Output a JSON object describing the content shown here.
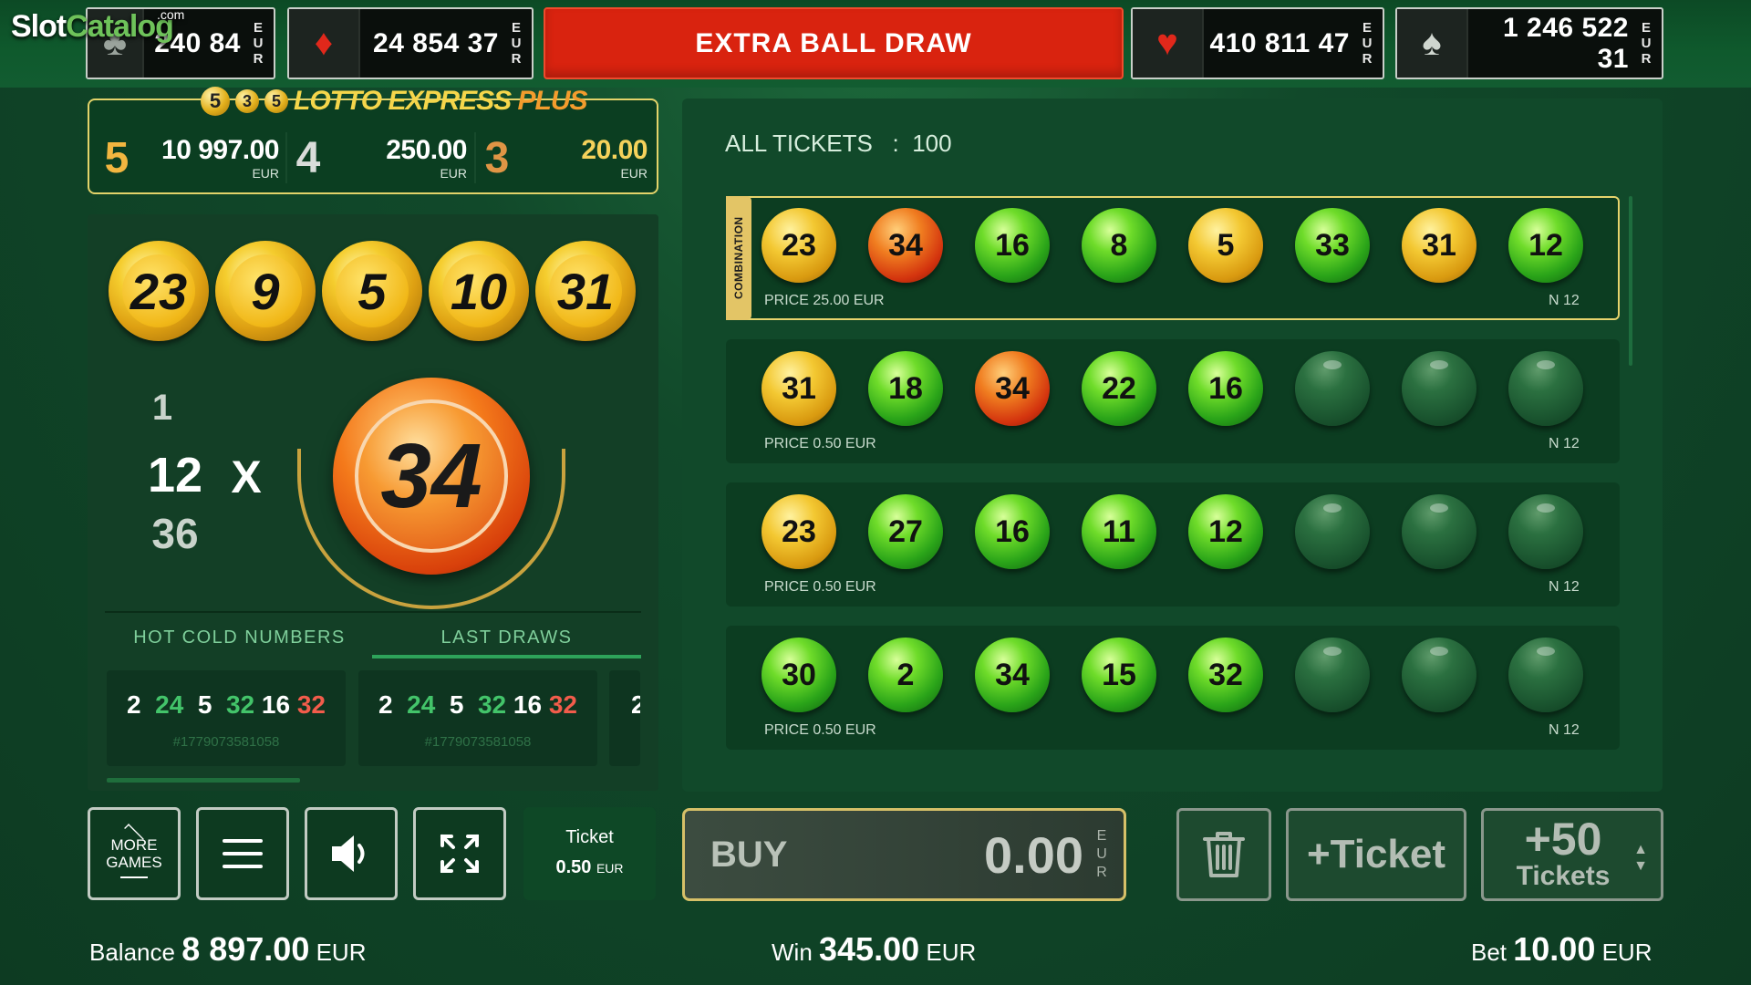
{
  "logo": {
    "slot": "Slot",
    "catalog": "Catalog",
    "com": ".com"
  },
  "jackpots": [
    {
      "suit": "club-icon",
      "value": "240 84",
      "currency": "EUR"
    },
    {
      "suit": "diamond-icon",
      "value": "24 854 37",
      "currency": "EUR"
    },
    {
      "suit": "heart-icon",
      "value": "410 811 47",
      "currency": "EUR"
    },
    {
      "suit": "spade-icon",
      "value": "1 246 522 31",
      "currency": "EUR"
    }
  ],
  "extra_ball_label": "EXTRA BALL DRAW",
  "paytable": {
    "title_balls": [
      "5",
      "3",
      "5"
    ],
    "title": "LOTTO EXPRESS",
    "title_plus": "PLUS",
    "rows": [
      {
        "match": "5",
        "amount": "10 997.00",
        "currency": "EUR"
      },
      {
        "match": "4",
        "amount": "250.00",
        "currency": "EUR"
      },
      {
        "match": "3",
        "amount": "20.00",
        "currency": "EUR"
      }
    ]
  },
  "drawn_balls": [
    "23",
    "9",
    "5",
    "10",
    "31"
  ],
  "current_ball": "34",
  "counter": {
    "prev": "1",
    "current": "12",
    "multiplier": "X",
    "total": "36"
  },
  "tabs": {
    "hot_cold": "HOT COLD NUMBERS",
    "last_draws": "LAST DRAWS"
  },
  "last_draws": [
    {
      "nums": [
        {
          "v": "2",
          "c": "w"
        },
        {
          "v": "24",
          "c": "g"
        },
        {
          "v": "5",
          "c": "w"
        },
        {
          "v": "32",
          "c": "g"
        },
        {
          "v": "16",
          "c": "w"
        },
        {
          "v": "32",
          "c": "r"
        }
      ],
      "id": "#1779073581058"
    },
    {
      "nums": [
        {
          "v": "2",
          "c": "w"
        },
        {
          "v": "24",
          "c": "g"
        },
        {
          "v": "5",
          "c": "w"
        },
        {
          "v": "32",
          "c": "g"
        },
        {
          "v": "16",
          "c": "w"
        },
        {
          "v": "32",
          "c": "r"
        }
      ],
      "id": "#1779073581058"
    },
    {
      "nums": [
        {
          "v": "2",
          "c": "w"
        }
      ],
      "id": ""
    }
  ],
  "buttons": {
    "more_games_1": "MORE",
    "more_games_2": "GAMES"
  },
  "ticket_box": {
    "label": "Ticket",
    "value": "0.50",
    "currency": "EUR"
  },
  "all_tickets": {
    "label": "ALL TICKETS",
    "sep": ":",
    "count": "100"
  },
  "combination_label": "COMBINATION",
  "tickets": [
    {
      "balls": [
        {
          "n": "23",
          "c": "gold"
        },
        {
          "n": "34",
          "c": "red"
        },
        {
          "n": "16",
          "c": "green"
        },
        {
          "n": "8",
          "c": "green"
        },
        {
          "n": "5",
          "c": "gold"
        },
        {
          "n": "33",
          "c": "green"
        },
        {
          "n": "31",
          "c": "gold"
        },
        {
          "n": "12",
          "c": "green"
        }
      ],
      "price": "PRICE 25.00 EUR",
      "n": "N 12"
    },
    {
      "balls": [
        {
          "n": "31",
          "c": "gold"
        },
        {
          "n": "18",
          "c": "green"
        },
        {
          "n": "34",
          "c": "red"
        },
        {
          "n": "22",
          "c": "green"
        },
        {
          "n": "16",
          "c": "green"
        },
        {
          "n": "",
          "c": "empty"
        },
        {
          "n": "",
          "c": "empty"
        },
        {
          "n": "",
          "c": "empty"
        }
      ],
      "price": "PRICE 0.50 EUR",
      "n": "N 12"
    },
    {
      "balls": [
        {
          "n": "23",
          "c": "gold"
        },
        {
          "n": "27",
          "c": "green"
        },
        {
          "n": "16",
          "c": "green"
        },
        {
          "n": "11",
          "c": "green"
        },
        {
          "n": "12",
          "c": "green"
        },
        {
          "n": "",
          "c": "empty"
        },
        {
          "n": "",
          "c": "empty"
        },
        {
          "n": "",
          "c": "empty"
        }
      ],
      "price": "PRICE 0.50 EUR",
      "n": "N 12"
    },
    {
      "balls": [
        {
          "n": "30",
          "c": "green"
        },
        {
          "n": "2",
          "c": "green"
        },
        {
          "n": "34",
          "c": "green"
        },
        {
          "n": "15",
          "c": "green"
        },
        {
          "n": "32",
          "c": "green"
        },
        {
          "n": "",
          "c": "empty"
        },
        {
          "n": "",
          "c": "empty"
        },
        {
          "n": "",
          "c": "empty"
        }
      ],
      "price": "PRICE 0.50 EUR",
      "n": "N 12"
    }
  ],
  "buy": {
    "label": "BUY",
    "amount": "0.00",
    "currency": "EUR"
  },
  "add_ticket_label": "+Ticket",
  "add_fifty": {
    "top": "+50",
    "bottom": "Tickets"
  },
  "footer": {
    "balance_label": "Balance",
    "balance_value": "8 897.00",
    "balance_cur": "EUR",
    "win_label": "Win",
    "win_value": "345.00",
    "win_cur": "EUR",
    "bet_label": "Bet",
    "bet_value": "10.00",
    "bet_cur": "EUR"
  },
  "colors": {
    "extra_ball": "#d9230f",
    "gold_border": "#e3d36a",
    "green_accent": "#2ea35a",
    "bg": "#11492a"
  }
}
